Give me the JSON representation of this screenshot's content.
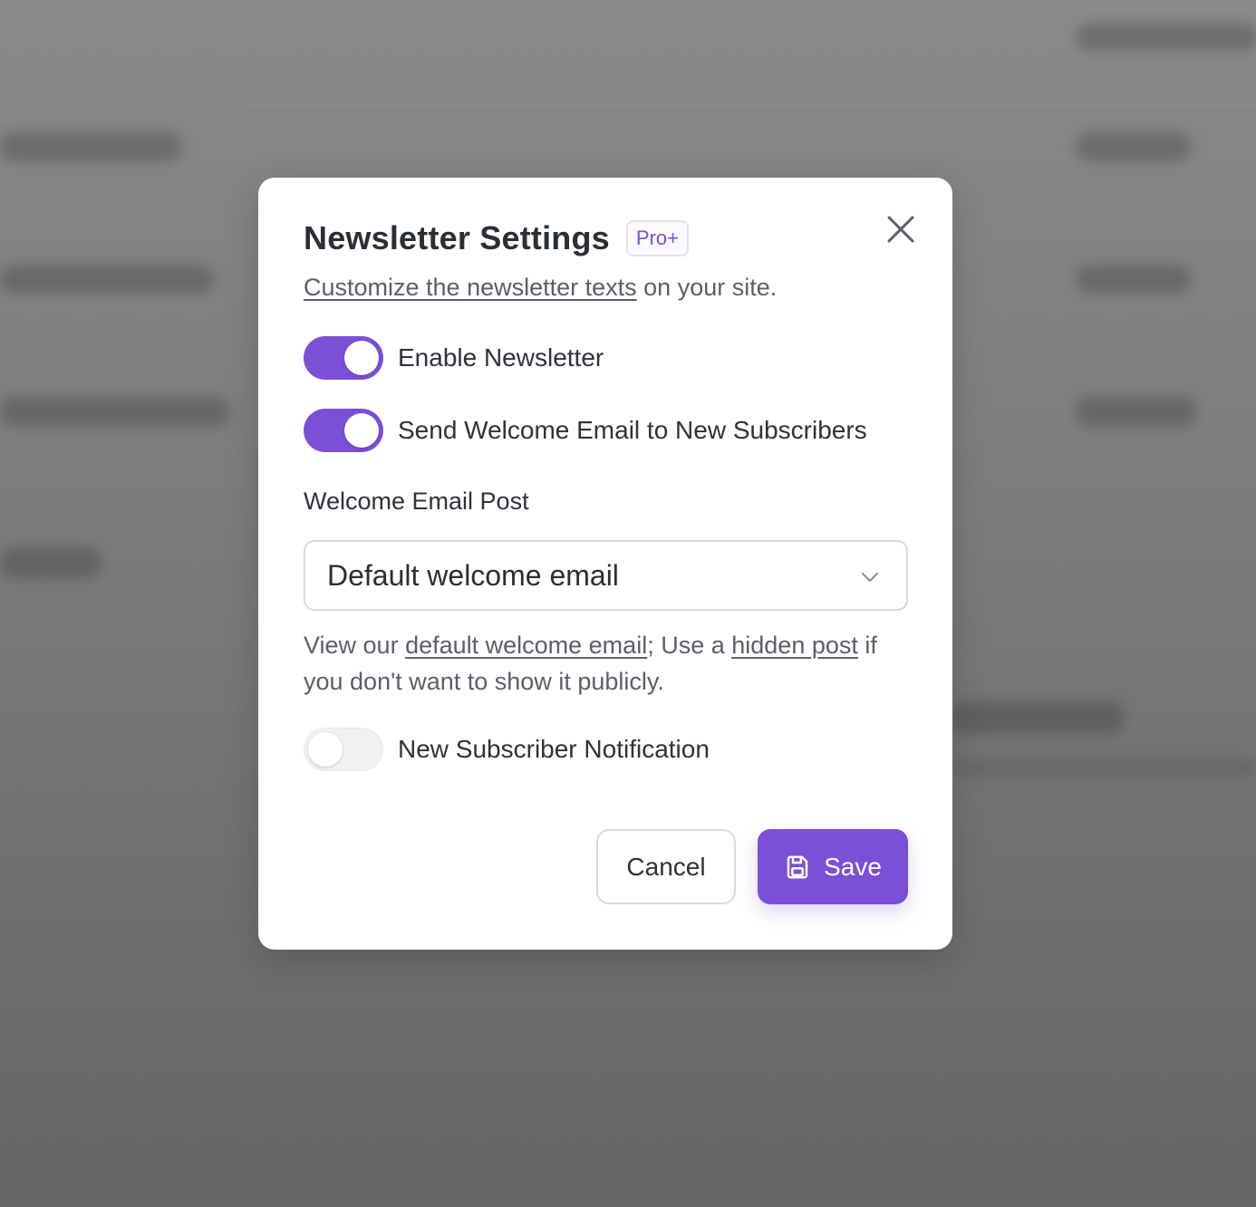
{
  "colors": {
    "accent": "#7b4fd6",
    "text_primary": "#2b2d38",
    "text_secondary": "#5b5e6a",
    "border": "#d9d9de"
  },
  "dialog": {
    "title": "Newsletter Settings",
    "badge": "Pro+",
    "close_icon": "close-icon",
    "subtitle_link": "Customize the newsletter texts",
    "subtitle_rest": " on your site."
  },
  "toggles": [
    {
      "label": "Enable Newsletter",
      "on": true
    },
    {
      "label": "Send Welcome Email to New Subscribers",
      "on": true
    },
    {
      "label": "New Subscriber Notification",
      "on": false
    }
  ],
  "welcome_email": {
    "label": "Welcome Email Post",
    "selected": "Default welcome email",
    "chevron_icon": "chevron-down-icon",
    "help_prefix": "View our ",
    "help_link1": "default welcome email",
    "help_middle": "; Use a ",
    "help_link2": "hidden post",
    "help_suffix": " if you don't want to show it publicly."
  },
  "actions": {
    "cancel": "Cancel",
    "save": "Save",
    "save_icon": "save-icon"
  }
}
